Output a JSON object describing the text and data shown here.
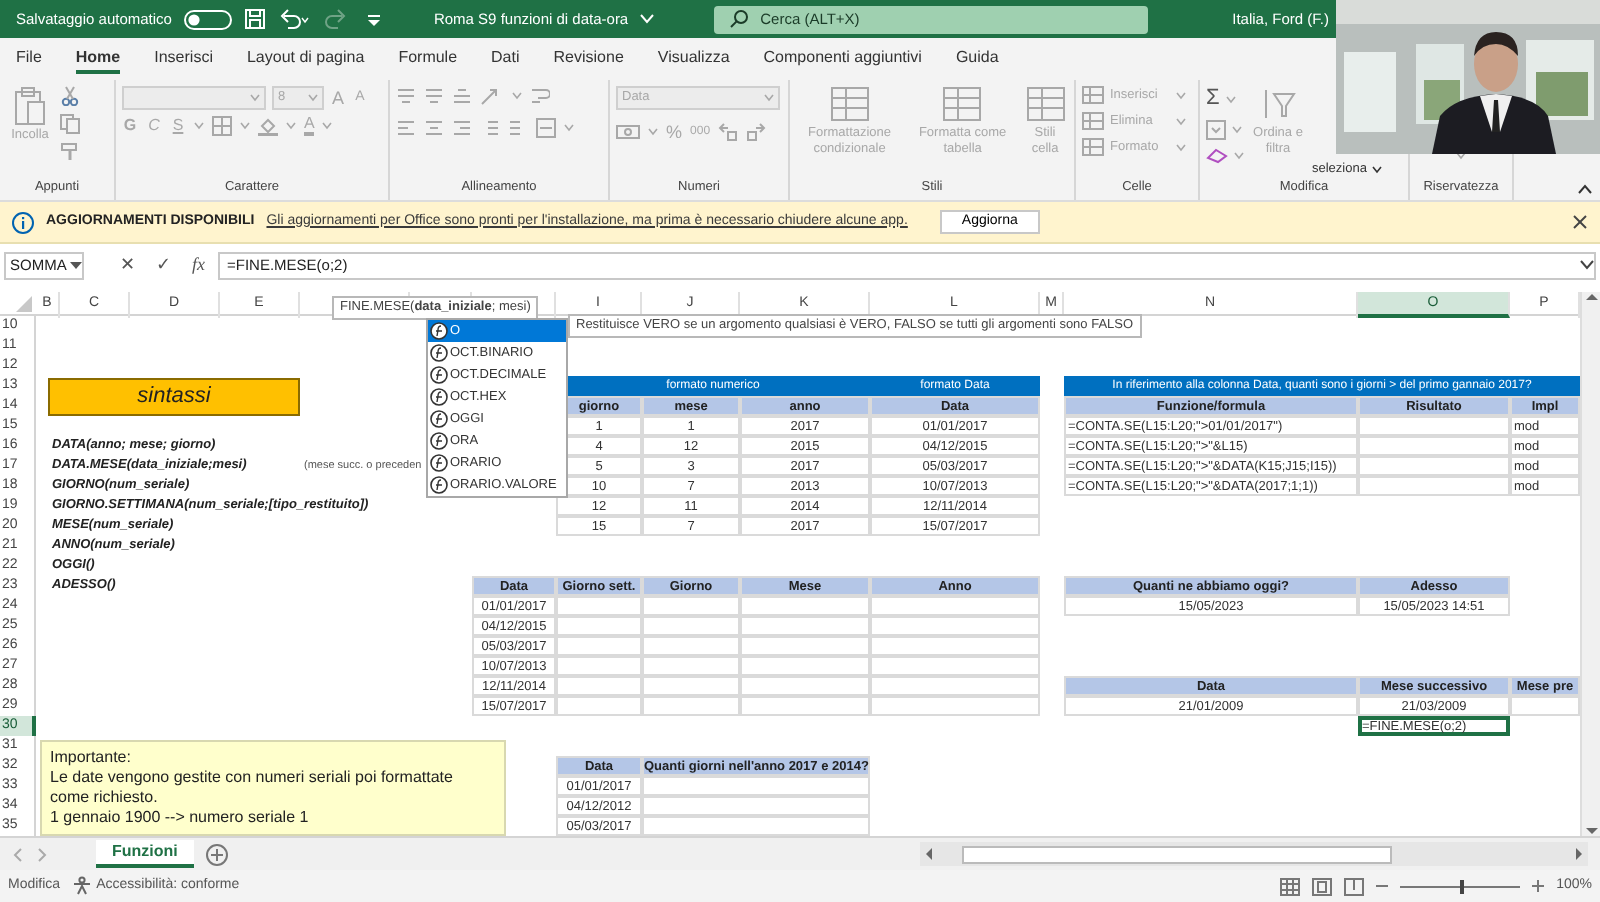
{
  "title_bar": {
    "autosave_label": "Salvataggio automatico",
    "autosave_on": false,
    "document_title": "Roma S9 funzioni di data-ora",
    "search_placeholder": "Cerca (ALT+X)",
    "user": "Italia, Ford (F.)"
  },
  "menu_tabs": [
    {
      "label": "File",
      "selected": false
    },
    {
      "label": "Home",
      "selected": true
    },
    {
      "label": "Inserisci",
      "selected": false
    },
    {
      "label": "Layout di pagina",
      "selected": false
    },
    {
      "label": "Formule",
      "selected": false
    },
    {
      "label": "Dati",
      "selected": false
    },
    {
      "label": "Revisione",
      "selected": false
    },
    {
      "label": "Visualizza",
      "selected": false
    },
    {
      "label": "Componenti aggiuntivi",
      "selected": false
    },
    {
      "label": "Guida",
      "selected": false
    }
  ],
  "ribbon": {
    "disabled": true,
    "groups": [
      "Appunti",
      "Carattere",
      "Allineamento",
      "Numeri",
      "Stili",
      "Celle",
      "Modifica",
      "Riservatezza"
    ],
    "paste": "Incolla",
    "font_size": "8",
    "grow_font": "A",
    "shrink_font": "A",
    "bold": "G",
    "italic": "C",
    "underline": "S",
    "font_color": "A",
    "number_format": "Data",
    "percent": "%",
    "thousands": "000",
    "conditional_format": "Formattazione condizionale",
    "format_table": "Formatta come tabella",
    "cell_styles": "Stili cella",
    "insert": "Inserisci",
    "delete": "Elimina",
    "format": "Formato",
    "sum": "Σ",
    "sort_filter": "Ordina e filtra",
    "select": "seleziona"
  },
  "info_bar": {
    "title": "AGGIORNAMENTI DISPONIBILI",
    "message": "Gli aggiornamenti per Office sono pronti per l'installazione, ma prima è necessario chiudere alcune app.",
    "button": "Aggiorna"
  },
  "formula_bar": {
    "name_box": "SOMMA",
    "cancel": "✕",
    "enter": "✓",
    "insert_function": "fx",
    "formula": "=FINE.MESE(o;2)"
  },
  "sheet": {
    "columns": [
      {
        "label": "B",
        "selected": false
      },
      {
        "label": "C",
        "selected": false
      },
      {
        "label": "D",
        "selected": false
      },
      {
        "label": "E",
        "selected": false
      },
      {
        "label": "I",
        "selected": false
      },
      {
        "label": "J",
        "selected": false
      },
      {
        "label": "K",
        "selected": false
      },
      {
        "label": "L",
        "selected": false
      },
      {
        "label": "M",
        "selected": false
      },
      {
        "label": "N",
        "selected": false
      },
      {
        "label": "O",
        "selected": true
      },
      {
        "label": "P",
        "selected": false
      }
    ],
    "rows": [
      {
        "label": "10",
        "selected": false
      },
      {
        "label": "11",
        "selected": false
      },
      {
        "label": "12",
        "selected": false
      },
      {
        "label": "13",
        "selected": false
      },
      {
        "label": "14",
        "selected": false
      },
      {
        "label": "15",
        "selected": false
      },
      {
        "label": "16",
        "selected": false
      },
      {
        "label": "17",
        "selected": false
      },
      {
        "label": "18",
        "selected": false
      },
      {
        "label": "19",
        "selected": false
      },
      {
        "label": "20",
        "selected": false
      },
      {
        "label": "21",
        "selected": false
      },
      {
        "label": "22",
        "selected": false
      },
      {
        "label": "23",
        "selected": false
      },
      {
        "label": "24",
        "selected": false
      },
      {
        "label": "25",
        "selected": false
      },
      {
        "label": "26",
        "selected": false
      },
      {
        "label": "27",
        "selected": false
      },
      {
        "label": "28",
        "selected": false
      },
      {
        "label": "29",
        "selected": false
      },
      {
        "label": "30",
        "selected": true
      },
      {
        "label": "31",
        "selected": false
      },
      {
        "label": "32",
        "selected": false
      },
      {
        "label": "33",
        "selected": false
      },
      {
        "label": "34",
        "selected": false
      },
      {
        "label": "35",
        "selected": false
      }
    ],
    "syntax_title": "sintassi",
    "syntax_lines": [
      "DATA(anno; mese; giorno)",
      "DATA.MESE(data_iniziale;mesi)",
      "GIORNO(num_seriale)",
      "GIORNO.SETTIMANA(num_seriale;[tipo_restituito])",
      "MESE(num_seriale)",
      "ANNO(num_seriale)",
      "OGGI()",
      "ADESSO()"
    ],
    "syntax_note": "(mese succ. o preceden",
    "table_numeric": {
      "group_headers": [
        "formato numerico",
        "formato Data"
      ],
      "columns": [
        "giorno",
        "mese",
        "anno",
        "Data"
      ],
      "rows": [
        [
          "1",
          "1",
          "2017",
          "01/01/2017"
        ],
        [
          "4",
          "12",
          "2015",
          "04/12/2015"
        ],
        [
          "5",
          "3",
          "2017",
          "05/03/2017"
        ],
        [
          "10",
          "7",
          "2013",
          "10/07/2013"
        ],
        [
          "12",
          "11",
          "2014",
          "12/11/2014"
        ],
        [
          "15",
          "7",
          "2017",
          "15/07/2017"
        ]
      ]
    },
    "table_count": {
      "title": "In riferimento alla colonna Data, quanti sono i giorni >  del primo gannaio 2017?",
      "columns": [
        "Funzione/formula",
        "Risultato",
        "Impl"
      ],
      "rows": [
        {
          "formula": "=CONTA.SE(L15:L20;\">01/01/2017\")",
          "column_3": "mod"
        },
        {
          "formula": "=CONTA.SE(L15:L20;\">\"&L15)",
          "column_3": "mod"
        },
        {
          "formula": "=CONTA.SE(L15:L20;\">\"&DATA(K15;J15;I15))",
          "column_3": "mod"
        },
        {
          "formula": "=CONTA.SE(L15:L20;\">\"&DATA(2017;1;1))",
          "column_3": "mod"
        }
      ]
    },
    "table_parts": {
      "columns": [
        "Data",
        "Giorno sett.",
        "Giorno",
        "Mese",
        "Anno"
      ],
      "dates": [
        "01/01/2017",
        "04/12/2015",
        "05/03/2017",
        "10/07/2013",
        "12/11/2014",
        "15/07/2017"
      ]
    },
    "table_today": {
      "columns": [
        "Quanti ne abbiamo oggi?",
        "Adesso"
      ],
      "values": [
        "15/05/2023",
        "15/05/2023 14:51"
      ]
    },
    "table_next_month": {
      "columns": [
        "Data",
        "Mese successivo",
        "Mese pre"
      ],
      "values": [
        "21/01/2009",
        "21/03/2009"
      ],
      "editing_cell": "=FINE.MESE(o;2)"
    },
    "note": [
      "Importante:",
      "Le date vengono gestite con numeri seriali poi formattate come richiesto.",
      "1 gennaio  1900 --> numero seriale 1"
    ],
    "table_years": {
      "columns": [
        "Data",
        "Quanti giorni nell'anno 2017 e 2014?"
      ],
      "dates": [
        "01/01/2017",
        "04/12/2012",
        "05/03/2017"
      ]
    }
  },
  "argument_tip": "FINE.MESE(**data_iniziale**; mesi)",
  "function_tip": "Restituisce VERO se un argomento qualsiasi è VERO, FALSO se tutti gli argomenti sono FALSO",
  "autocomplete": [
    {
      "label": "O",
      "selected": true
    },
    {
      "label": "OCT.BINARIO",
      "selected": false
    },
    {
      "label": "OCT.DECIMALE",
      "selected": false
    },
    {
      "label": "OCT.HEX",
      "selected": false
    },
    {
      "label": "OGGI",
      "selected": false
    },
    {
      "label": "ORA",
      "selected": false
    },
    {
      "label": "ORARIO",
      "selected": false
    },
    {
      "label": "ORARIO.VALORE",
      "selected": false
    }
  ],
  "sheet_tabs": [
    {
      "label": "Funzioni",
      "selected": true
    }
  ],
  "status_bar": {
    "mode": "Modifica",
    "accessibility": "Accessibilità: conforme",
    "zoom_slider": {
      "level": 0.5
    },
    "zoom": "100%"
  }
}
